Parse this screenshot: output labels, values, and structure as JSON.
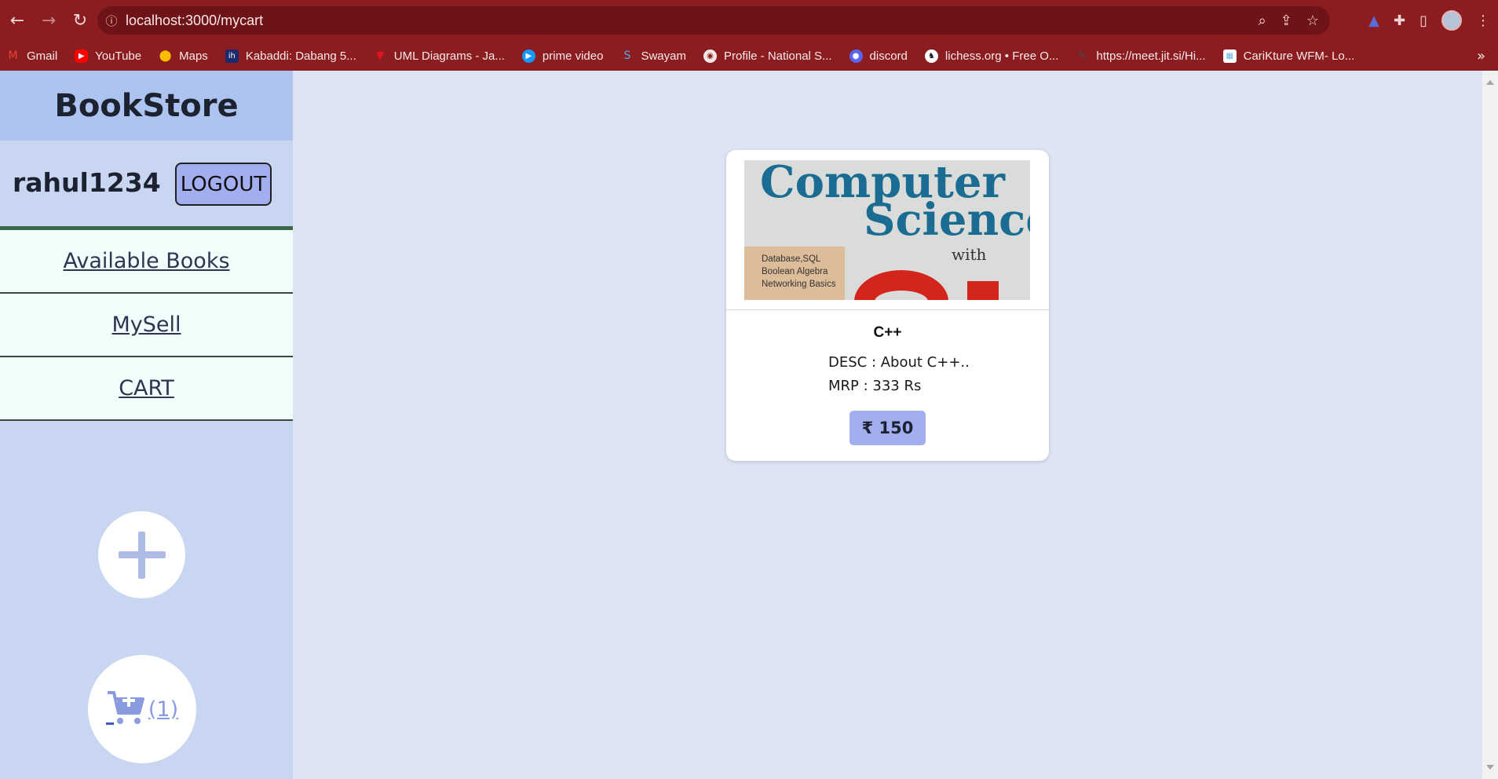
{
  "browser": {
    "url": "localhost:3000/mycart",
    "bookmarks": [
      {
        "label": "Gmail",
        "icon": "gmail-icon",
        "color": "#c5221f"
      },
      {
        "label": "YouTube",
        "icon": "youtube-icon",
        "color": "#ff0000"
      },
      {
        "label": "Maps",
        "icon": "maps-icon",
        "color": "#34a853"
      },
      {
        "label": "Kabaddi: Dabang 5...",
        "icon": "kabaddi-icon",
        "color": "#1a2a6c"
      },
      {
        "label": "UML Diagrams - Ja...",
        "icon": "uml-icon",
        "color": "#e0141e"
      },
      {
        "label": "prime video",
        "icon": "prime-video-icon",
        "color": "#1399ff"
      },
      {
        "label": "Swayam",
        "icon": "swayam-icon",
        "color": "#1b75bc"
      },
      {
        "label": "Profile - National S...",
        "icon": "globe-icon",
        "color": "#6c6c6c"
      },
      {
        "label": "discord",
        "icon": "discord-icon",
        "color": "#5865f2"
      },
      {
        "label": "lichess.org • Free O...",
        "icon": "lichess-icon",
        "color": "#ffffff"
      },
      {
        "label": "https://meet.jit.si/Hi...",
        "icon": "jitsi-icon",
        "color": "#4a4a4a"
      },
      {
        "label": "CariKture WFM- Lo...",
        "icon": "carikture-icon",
        "color": "#6fb3e0"
      }
    ]
  },
  "sidebar": {
    "brand": "BookStore",
    "username": "rahul1234",
    "logout_label": "LOGOUT",
    "links": {
      "available_books": "Available Books",
      "my_sell": "MySell",
      "cart": "CART"
    },
    "cart_count": "(1)"
  },
  "card": {
    "cover": {
      "line1": "Computer",
      "line2": "Science",
      "line3": "with",
      "topics": [
        "Database,SQL",
        "Boolean Algebra",
        "Networking Basics"
      ]
    },
    "title": "C++",
    "desc": "DESC : About C++..",
    "mrp": "MRP : 333 Rs",
    "price": "₹ 150"
  }
}
